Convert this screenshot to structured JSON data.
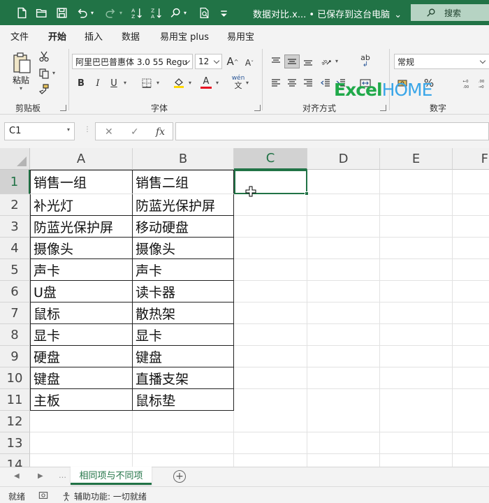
{
  "window": {
    "title": "数据对比.x... • 已保存到这台电脑",
    "title_chevron": "⌄",
    "search_label": "搜索"
  },
  "ribbon_tabs": [
    "文件",
    "开始",
    "插入",
    "数据",
    "易用宝 plus",
    "易用宝"
  ],
  "ribbon": {
    "clipboard": {
      "paste_label": "粘贴",
      "group_label": "剪贴板"
    },
    "font": {
      "font_name": "阿里巴巴普惠体 3.0 55 Regu",
      "font_size": "12",
      "grow": "A",
      "shrink": "A",
      "bold": "B",
      "italic": "I",
      "underline": "U",
      "font_color_letter": "A",
      "phonetic": "wén",
      "phonetic_char": "文",
      "group_label": "字体"
    },
    "alignment": {
      "group_label": "对齐方式",
      "wrap_label": "ab"
    },
    "number": {
      "format": "常规",
      "percent": "%",
      "group_label": "数字"
    }
  },
  "logo": {
    "part1": "Excel",
    "part2": "HOME"
  },
  "formula_bar": {
    "name_box": "C1",
    "fx": "fx",
    "cancel": "✕",
    "enter": "✓",
    "value": ""
  },
  "columns": [
    "A",
    "B",
    "C",
    "D",
    "E",
    "F"
  ],
  "rows": [
    "1",
    "2",
    "3",
    "4",
    "5",
    "6",
    "7",
    "8",
    "9",
    "10",
    "11",
    "12",
    "13",
    "14"
  ],
  "cells": [
    [
      "销售一组",
      "销售二组"
    ],
    [
      "补光灯",
      "防蓝光保护屏"
    ],
    [
      "防蓝光保护屏",
      "移动硬盘"
    ],
    [
      "摄像头",
      "摄像头"
    ],
    [
      "声卡",
      "声卡"
    ],
    [
      "U盘",
      "读卡器"
    ],
    [
      "鼠标",
      "散热架"
    ],
    [
      "显卡",
      "显卡"
    ],
    [
      "硬盘",
      "键盘"
    ],
    [
      "键盘",
      "直播支架"
    ],
    [
      "主板",
      "鼠标垫"
    ]
  ],
  "selected_cell": "C1",
  "sheets": [
    {
      "name": "相同项与不同项",
      "active": true
    }
  ],
  "add_sheet": "+",
  "status": {
    "ready": "就绪",
    "accessibility": "辅助功能: 一切就绪"
  },
  "colors": {
    "accent": "#217346",
    "ribbon_bg": "#f3f3f3",
    "logo_green": "#20a94a",
    "logo_blue": "#3aa6e8"
  }
}
